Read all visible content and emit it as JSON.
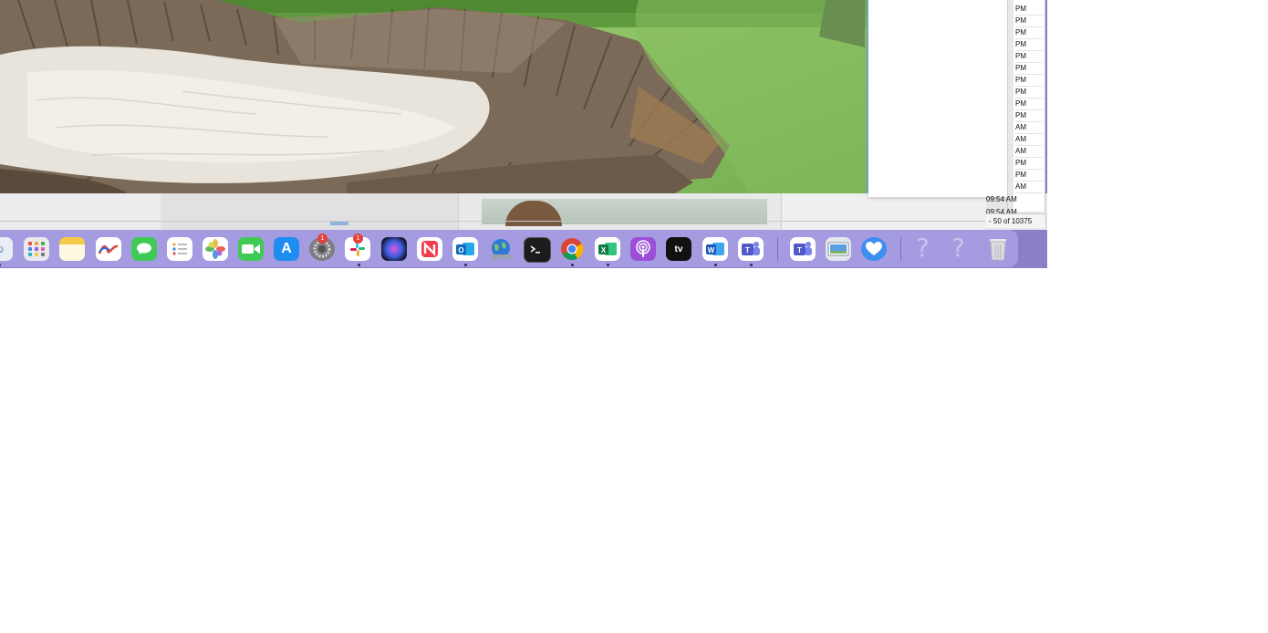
{
  "list_panel": {
    "ampm": [
      "PM",
      "PM",
      "PM",
      "PM",
      "PM",
      "PM",
      "PM",
      "PM",
      "PM",
      "PM",
      "AM",
      "AM",
      "AM",
      "PM",
      "PM",
      "AM"
    ],
    "time_1": "09:54 AM",
    "time_2": "09:54 AM",
    "count_text": "- 50 of 10375"
  },
  "dock": {
    "badges": {
      "system_settings": "1",
      "slack": "1"
    },
    "icons": [
      "finder-icon",
      "launchpad-icon",
      "notes-icon",
      "freeform-icon",
      "messages-icon",
      "reminders-icon",
      "photos-icon",
      "facetime-icon",
      "app-store-icon",
      "system-settings-icon",
      "slack-icon",
      "siri-icon",
      "news-icon",
      "outlook-icon",
      "network-utility-icon",
      "terminal-icon",
      "chrome-icon",
      "excel-icon",
      "podcasts-icon",
      "apple-tv-icon",
      "word-icon",
      "teams-icon",
      "teams-alt-icon",
      "preview-icon",
      "heart-app-icon",
      "unknown-app-icon",
      "unknown-app-icon",
      "trash-icon"
    ],
    "unknown_glyph": "?"
  },
  "colors": {
    "dock_bg": "#a59be0",
    "accent": "#7ea8d6"
  }
}
